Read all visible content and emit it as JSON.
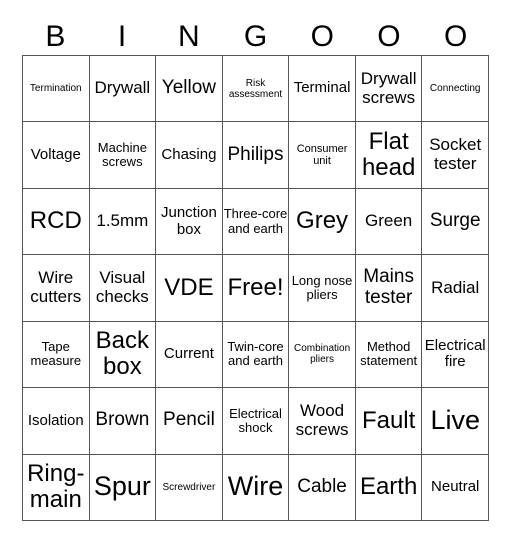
{
  "header": {
    "letters": [
      "B",
      "I",
      "N",
      "G",
      "O",
      "O",
      "O"
    ]
  },
  "board": {
    "rows": [
      [
        "Termination",
        "Drywall",
        "Yellow",
        "Risk assessment",
        "Terminal",
        "Drywall screws",
        "Connecting"
      ],
      [
        "Voltage",
        "Machine screws",
        "Chasing",
        "Philips",
        "Consumer unit",
        "Flat head",
        "Socket tester"
      ],
      [
        "RCD",
        "1.5mm",
        "Junction box",
        "Three-core and earth",
        "Grey",
        "Green",
        "Surge"
      ],
      [
        "Wire cutters",
        "Visual checks",
        "VDE",
        "Free!",
        "Long nose pliers",
        "Mains tester",
        "Radial"
      ],
      [
        "Tape measure",
        "Back box",
        "Current",
        "Twin-core and earth",
        "Combination pliers",
        "Method statement",
        "Electrical fire"
      ],
      [
        "Isolation",
        "Brown",
        "Pencil",
        "Electrical shock",
        "Wood screws",
        "Fault",
        "Live"
      ],
      [
        "Ring-main",
        "Spur",
        "Screwdriver",
        "Wire",
        "Cable",
        "Earth",
        "Neutral"
      ]
    ],
    "free_space": "Free!"
  },
  "colors": {
    "grid_line": "#555555",
    "text": "#000000",
    "background": "#ffffff"
  }
}
